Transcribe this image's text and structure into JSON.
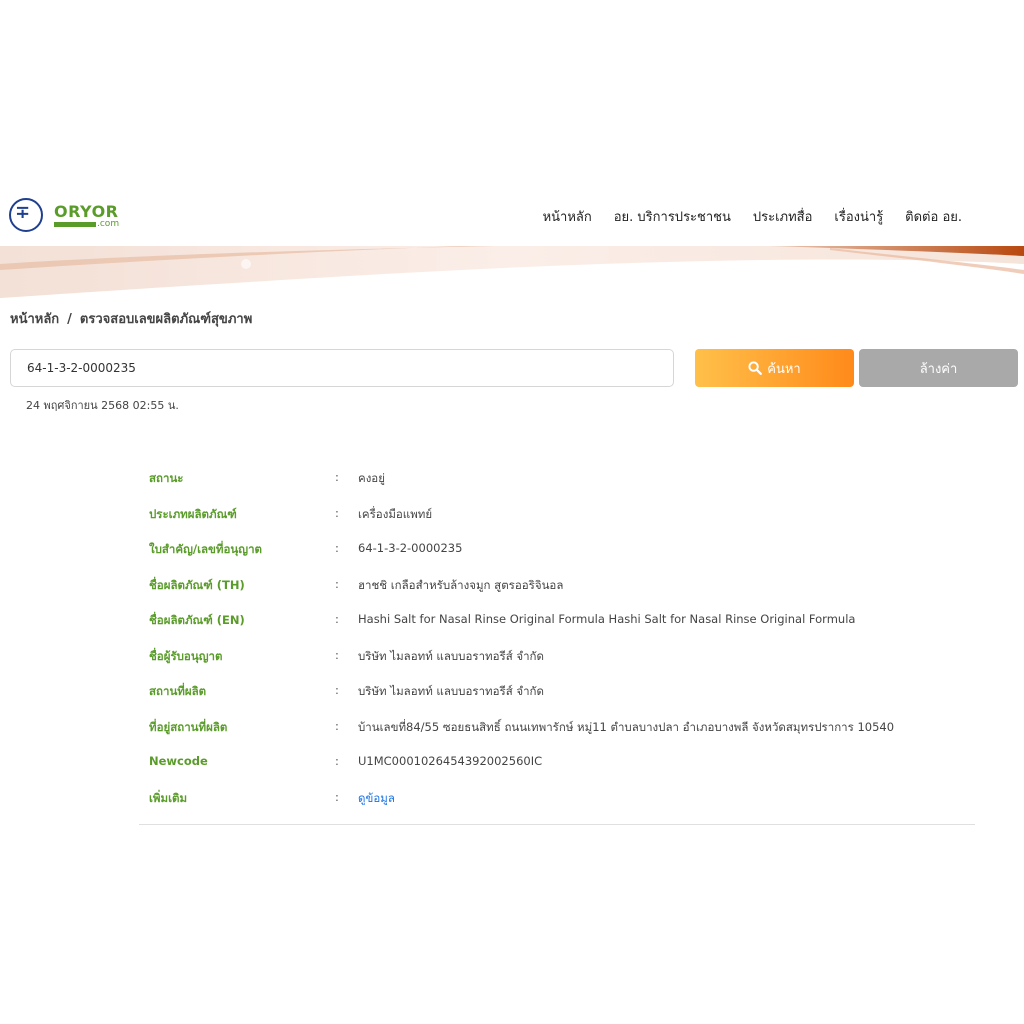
{
  "header": {
    "logo_text": "ORYOR",
    "logo_sub": ".com",
    "nav": [
      "หน้าหลัก",
      "อย. บริการประชาชน",
      "ประเภทสื่อ",
      "เรื่องน่ารู้",
      "ติดต่อ อย."
    ]
  },
  "breadcrumb": {
    "home": "หน้าหลัก",
    "separator": "/",
    "current": "ตรวจสอบเลขผลิตภัณฑ์สุขภาพ"
  },
  "search": {
    "value": "64-1-3-2-0000235",
    "search_label": "ค้นหา",
    "clear_label": "ล้างค่า",
    "timestamp": "24 พฤศจิกายน 2568 02:55 น."
  },
  "details": [
    {
      "label": "สถานะ",
      "value": "คงอยู่"
    },
    {
      "label": "ประเภทผลิตภัณฑ์",
      "value": "เครื่องมือแพทย์"
    },
    {
      "label": "ใบสำคัญ/เลขที่อนุญาต",
      "value": "64-1-3-2-0000235"
    },
    {
      "label": "ชื่อผลิตภัณฑ์ (TH)",
      "value": "ฮาชชิ เกลือสำหรับล้างจมูก สูตรออริจินอล"
    },
    {
      "label": "ชื่อผลิตภัณฑ์ (EN)",
      "value": "Hashi Salt for Nasal Rinse Original Formula Hashi Salt for Nasal Rinse Original Formula"
    },
    {
      "label": "ชื่อผู้รับอนุญาต",
      "value": "บริษัท ไมลอทท์ แลบบอราทอรีส์ จำกัด"
    },
    {
      "label": "สถานที่ผลิต",
      "value": "บริษัท ไมลอทท์ แลบบอราทอรีส์ จำกัด"
    },
    {
      "label": "ที่อยู่สถานที่ผลิต",
      "value": "บ้านเลขที่84/55 ซอยธนสิทธิ์ ถนนเทพารักษ์ หมู่11 ตำบลบางปลา อำเภอบางพลี จังหวัดสมุทรปราการ 10540"
    },
    {
      "label": "Newcode",
      "value": "U1MC0001026454392002560IC"
    },
    {
      "label": "เพิ่มเติม",
      "value": "ดูข้อมูล"
    }
  ],
  "colon": ":",
  "colors": {
    "label_green": "#5a9c2a",
    "link_blue": "#1a73e8",
    "search_start": "#ffc04a",
    "search_end": "#ff8a1a",
    "clear_gray": "#a9a9a9"
  }
}
